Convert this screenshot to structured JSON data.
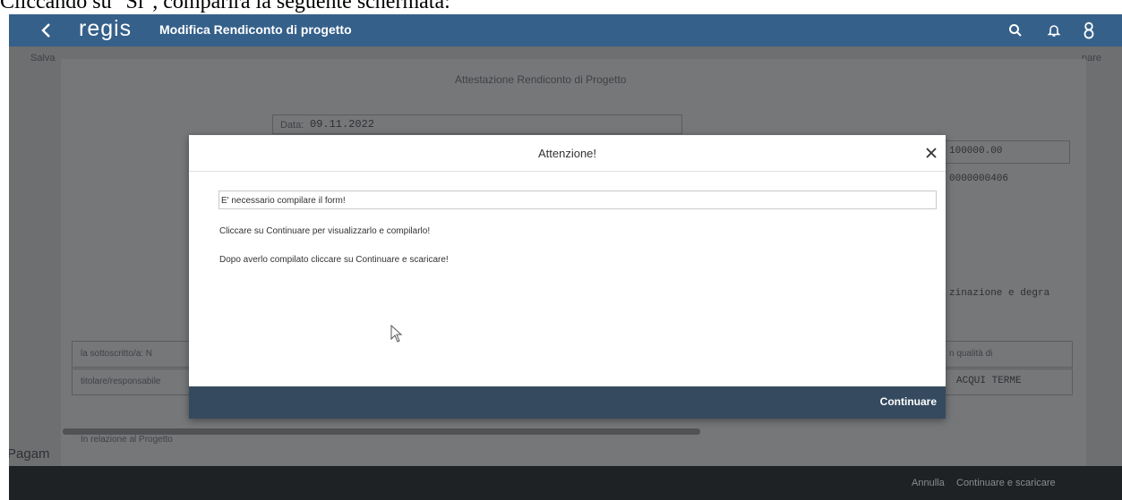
{
  "caption": "Cliccando su \"Sì\", comparirà la seguente schermata:",
  "header": {
    "logo": "regis",
    "title": "Modifica Rendiconto di progetto",
    "icons": [
      "back-icon",
      "search-icon",
      "bell-icon",
      "user-icon"
    ]
  },
  "toolbar": {
    "left_label": "Salva",
    "right_label": "nare"
  },
  "background": {
    "doc_title": "Attestazione Rendiconto di Progetto",
    "date_label": "Data:",
    "date_value": "09.11.2022",
    "field1_value": "100000.00",
    "field2_value": "0000000406",
    "field3_value": "zinazione e degra",
    "sotto_label": "la sottoscritto/a: N",
    "qualita_label": "n qualità di",
    "titolare_label": "titolare/responsabile",
    "city_value": "ACQUI TERME",
    "relazione_label": "In relazione al Progetto",
    "pagam_label": "Pagam"
  },
  "dialog": {
    "title": "Attenzione!",
    "lines": [
      "E' necessario compilare il form!",
      "Cliccare su Continuare per visualizzarlo e compilarlo!",
      "Dopo averlo compilato cliccare su Continuare e scaricare!"
    ],
    "continue_label": "Continuare"
  },
  "footer": {
    "cancel_label": "Annulla",
    "continue_download_label": "Continuare e scaricare"
  }
}
